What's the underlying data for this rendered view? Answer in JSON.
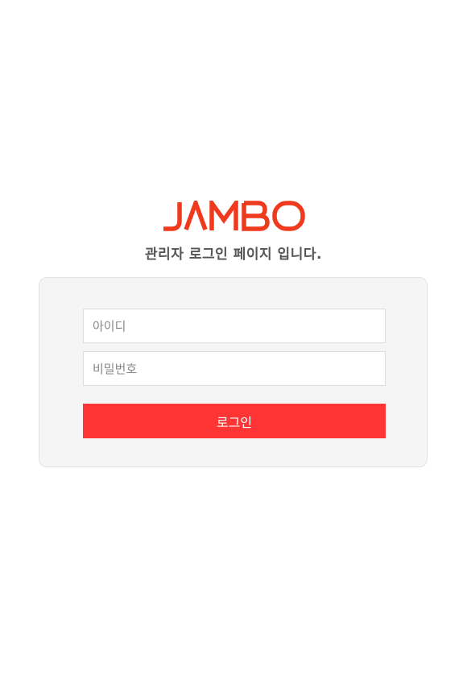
{
  "brand": {
    "logo_text": "JAMBO",
    "logo_color": "#f03a1e"
  },
  "subtitle": "관리자 로그인 페이지 입니다.",
  "form": {
    "id_placeholder": "아이디",
    "password_placeholder": "비밀번호",
    "login_label": "로그인"
  },
  "colors": {
    "accent": "#ff3434",
    "panel_background": "#f5f5f5",
    "subtitle_text": "#555555"
  }
}
